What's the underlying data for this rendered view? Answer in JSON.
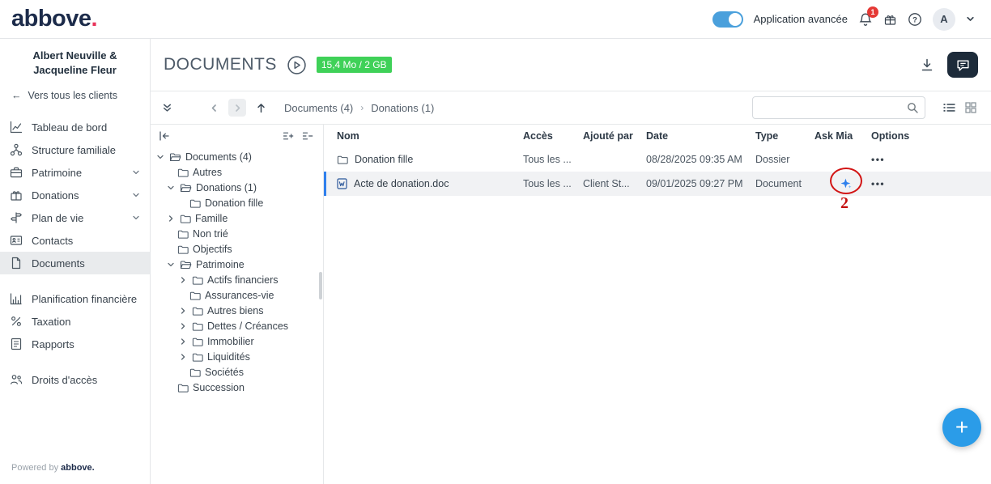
{
  "colors": {
    "accent_blue": "#2f80ed",
    "fab_blue": "#2b9ce8",
    "storage_badge_green": "#3fd158",
    "brand_navy": "#1c2b4a",
    "logo_dot_pink": "#e8335a",
    "notification_red": "#e53935",
    "annotation_red": "#d21414",
    "selected_row_gray": "#f1f2f4"
  },
  "topbar": {
    "logo_text": "abbove",
    "logo_dot": ".",
    "toggle_label": "Application avancée",
    "notification_count": "1",
    "avatar_initial": "A"
  },
  "sidebar": {
    "client_name": "Albert Neuville & Jacqueline Fleur",
    "back_arrow": "←",
    "back_link_label": "Vers tous les clients",
    "nav_primary": [
      {
        "label": "Tableau de bord"
      },
      {
        "label": "Structure familiale"
      },
      {
        "label": "Patrimoine"
      },
      {
        "label": "Donations"
      },
      {
        "label": "Plan de vie"
      },
      {
        "label": "Contacts"
      },
      {
        "label": "Documents"
      }
    ],
    "nav_secondary": [
      {
        "label": "Planification financière"
      },
      {
        "label": "Taxation"
      },
      {
        "label": "Rapports"
      }
    ],
    "nav_tertiary": [
      {
        "label": "Droits d'accès"
      }
    ],
    "footer_text": "Powered by",
    "footer_brand": "abbove."
  },
  "main": {
    "page_title": "DOCUMENTS",
    "storage_usage": "15,4 Mo / 2 GB",
    "breadcrumb": {
      "items": [
        "Documents (4)",
        "Donations (1)"
      ],
      "separator": "›"
    },
    "fab_label": "+",
    "tree": {
      "items": [
        {
          "label": "Documents (4)"
        },
        {
          "label": "Autres"
        },
        {
          "label": "Donations (1)"
        },
        {
          "label": "Donation fille"
        },
        {
          "label": "Famille"
        },
        {
          "label": "Non trié"
        },
        {
          "label": "Objectifs"
        },
        {
          "label": "Patrimoine"
        },
        {
          "label": "Actifs financiers"
        },
        {
          "label": "Assurances-vie"
        },
        {
          "label": "Autres biens"
        },
        {
          "label": "Dettes / Créances"
        },
        {
          "label": "Immobilier"
        },
        {
          "label": "Liquidités"
        },
        {
          "label": "Sociétés"
        },
        {
          "label": "Succession"
        }
      ]
    },
    "table": {
      "columns": {
        "name": "Nom",
        "access": "Accès",
        "added_by": "Ajouté par",
        "date": "Date",
        "type": "Type",
        "ask_mia": "Ask Mia",
        "options": "Options"
      },
      "rows": [
        {
          "name": "Donation fille",
          "access": "Tous les ...",
          "added_by": "",
          "date": "08/28/2025 09:35 AM",
          "type": "Dossier",
          "options": "•••"
        },
        {
          "name": "Acte de donation.doc",
          "access": "Tous les ...",
          "added_by": "Client St...",
          "date": "09/01/2025 09:27 PM",
          "type": "Document",
          "options": "•••"
        }
      ]
    },
    "annotation": {
      "step_number": "2"
    }
  }
}
